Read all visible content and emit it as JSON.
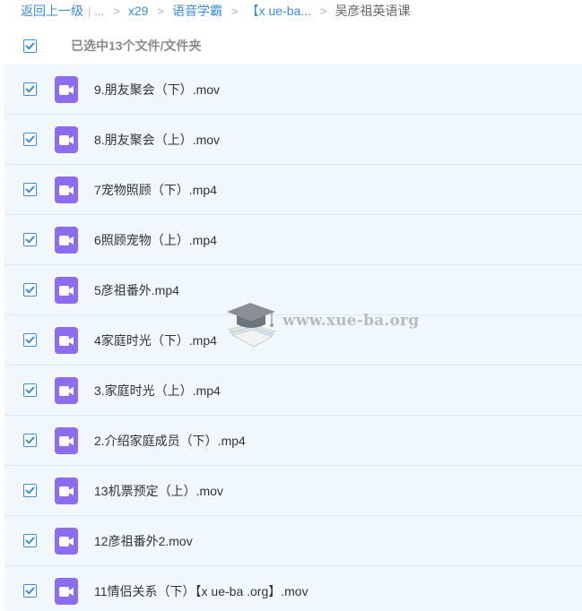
{
  "breadcrumb": {
    "back_label": "返回上一级",
    "pipe": "|",
    "ellipsis": "...",
    "separator": ">",
    "items": [
      {
        "label": "x29"
      },
      {
        "label": "语音学霸"
      },
      {
        "label": "【x ue-ba..."
      }
    ],
    "current": "吴彦祖英语课"
  },
  "selection": {
    "all_checked": true,
    "summary": "已选中13个文件/文件夹"
  },
  "files": [
    {
      "name": "9.朋友聚会（下）.mov",
      "checked": true
    },
    {
      "name": "8.朋友聚会（上）.mov",
      "checked": true
    },
    {
      "name": "7宠物照顾（下）.mp4",
      "checked": true
    },
    {
      "name": "6照顾宠物（上）.mp4",
      "checked": true
    },
    {
      "name": "5彦祖番外.mp4",
      "checked": true
    },
    {
      "name": "4家庭时光（下）.mp4",
      "checked": true
    },
    {
      "name": "3.家庭时光（上）.mp4",
      "checked": true
    },
    {
      "name": "2.介绍家庭成员（下）.mp4",
      "checked": true
    },
    {
      "name": "13机票预定（上）.mov",
      "checked": true
    },
    {
      "name": "12彦祖番外2.mov",
      "checked": true
    },
    {
      "name": "11情侣关系（下）【x ue-ba .org】.mov",
      "checked": true
    }
  ],
  "watermark": {
    "text": "www.xue-ba.org"
  },
  "icons": {
    "file_icon": "video-file-icon",
    "checkbox": "checkmark-icon",
    "watermark_logo": "graduation-cap-icon"
  },
  "colors": {
    "accent": "#3b8cd9",
    "row_background": "#f1f8fd",
    "row_divider": "#dce9f2",
    "video_icon": "#8e6cf0"
  }
}
